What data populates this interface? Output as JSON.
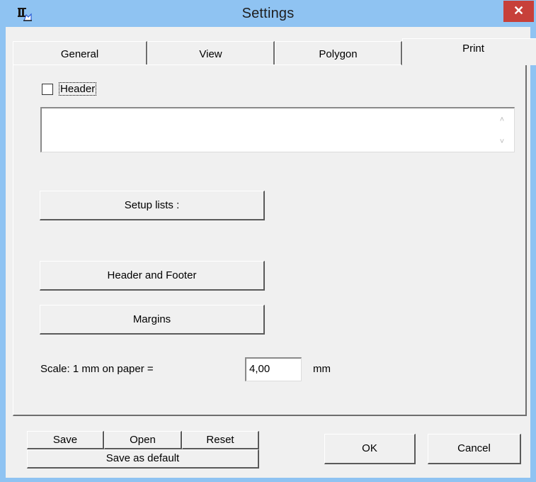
{
  "window": {
    "title": "Settings",
    "close_glyph": "✕",
    "icon": "app-icon"
  },
  "tabs": [
    {
      "label": "General",
      "active": false
    },
    {
      "label": "View",
      "active": false
    },
    {
      "label": "Polygon",
      "active": false
    },
    {
      "label": "Print",
      "active": true
    }
  ],
  "print": {
    "header_checkbox_label": "Header",
    "header_checked": false,
    "header_text": "",
    "setup_lists_label": "Setup lists :",
    "header_footer_label": "Header and Footer",
    "margins_label": "Margins",
    "scale_label": "Scale: 1 mm on paper =",
    "scale_value": "4,00",
    "scale_unit": "mm"
  },
  "footer": {
    "save_label": "Save",
    "open_label": "Open",
    "reset_label": "Reset",
    "save_default_label": "Save as default",
    "ok_label": "OK",
    "cancel_label": "Cancel"
  },
  "colors": {
    "titlebar": "#8fc3f2",
    "close_button": "#c7403a",
    "dialog_background": "#f0f0f0"
  }
}
